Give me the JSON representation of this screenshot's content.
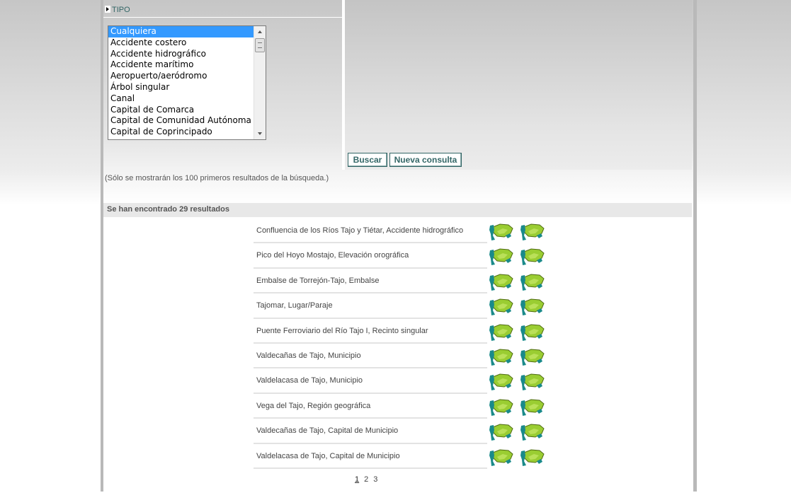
{
  "filter": {
    "section_label": "TIPO",
    "options": [
      "Cualquiera",
      "Accidente costero",
      "Accidente hidrográfico",
      "Accidente marítimo",
      "Aeropuerto/aeródromo",
      "Árbol singular",
      "Canal",
      "Capital de Comarca",
      "Capital de Comunidad Autónoma",
      "Capital de Coprincipado"
    ],
    "selected": "Cualquiera"
  },
  "actions": {
    "search_label": "Buscar",
    "new_query_label": "Nueva consulta"
  },
  "note": "(Sólo se mostrarán los 100 primeros resultados de la búsqueda.)",
  "results": {
    "count_text": "Se han encontrado 29 resultados",
    "items": [
      "Confluencia de los Ríos Tajo y Tiétar, Accidente hidrográfico",
      "Pico del Hoyo Mostajo, Elevación orográfica",
      "Embalse de Torrejón-Tajo, Embalse",
      "Tajomar, Lugar/Paraje",
      "Puente Ferroviario del Río Tajo I, Recinto singular",
      "Valdecañas de Tajo, Municipio",
      "Valdelacasa de Tajo, Municipio",
      "Vega del Tajo, Región geográfica",
      "Valdecañas de Tajo, Capital de Municipio",
      "Valdelacasa de Tajo, Capital de Municipio"
    ]
  },
  "pagination": {
    "pages": [
      "1",
      "2",
      "3"
    ],
    "current": "1"
  },
  "colors": {
    "accent": "#336666",
    "map_green": "#9acd32",
    "map_teal": "#1a8a8a"
  }
}
